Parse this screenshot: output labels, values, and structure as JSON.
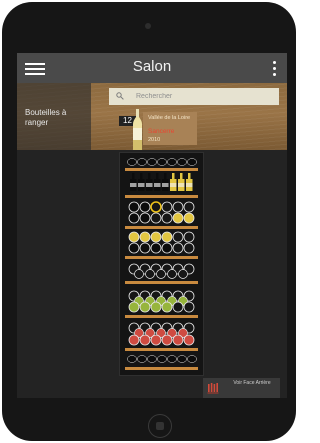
{
  "header": {
    "title": "Salon",
    "menu_icon": "hamburger-menu-icon",
    "more_icon": "vertical-dots-icon"
  },
  "sidebar": {
    "label": "Bouteilles à ranger"
  },
  "search": {
    "placeholder": "Rechercher",
    "icon": "search-icon"
  },
  "selected_wine": {
    "count": "12",
    "region": "Vallée de la Loire",
    "name": "Sancerre",
    "year": "2010"
  },
  "cellar": {
    "selected_slot_color": "#f0c419",
    "rack_colors": {
      "wood": "#c88a3f",
      "empty": "#e9e9e9",
      "yellow": "#e2c641",
      "green": "#97b53c",
      "red": "#cf4b41",
      "black": "#0c0c0c"
    }
  },
  "back_view": {
    "label": "Voir Face Arrière",
    "icon": "bottle-rack-icon"
  },
  "device": {
    "home_icon": "home-button-icon"
  }
}
